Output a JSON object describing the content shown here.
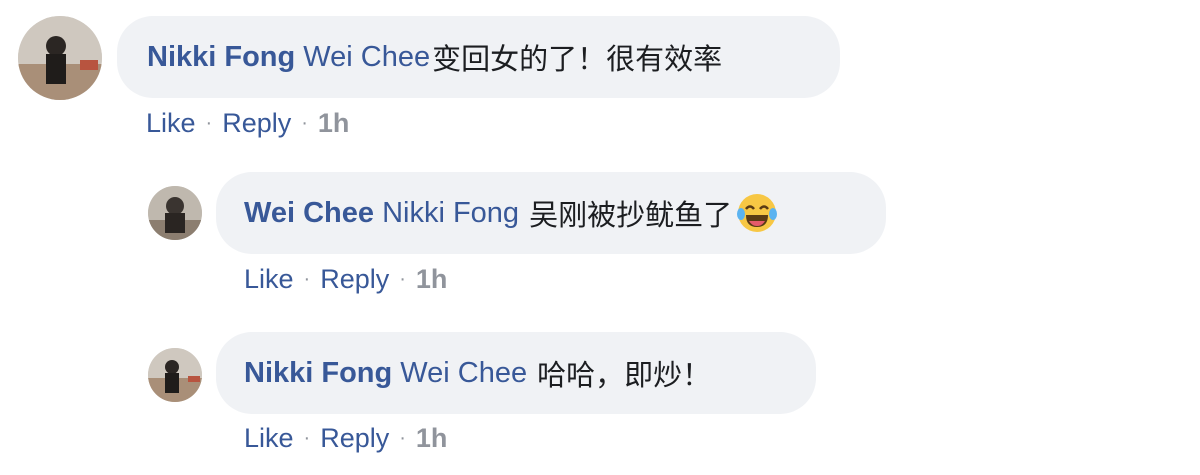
{
  "comments": [
    {
      "author": "Nikki Fong",
      "mention": "Wei Chee",
      "text": "变回女的了！很有效率",
      "actions": {
        "like": "Like",
        "reply": "Reply",
        "time": "1h"
      }
    },
    {
      "author": "Wei Chee",
      "mention": "Nikki Fong",
      "text": "吴刚被抄鱿鱼了",
      "emoji": "laughing-tears-emoji",
      "actions": {
        "like": "Like",
        "reply": "Reply",
        "time": "1h"
      }
    },
    {
      "author": "Nikki Fong",
      "mention": "Wei Chee",
      "text": "哈哈，即炒！",
      "actions": {
        "like": "Like",
        "reply": "Reply",
        "time": "1h"
      }
    }
  ],
  "colors": {
    "link": "#385898",
    "bubble": "#f0f2f5",
    "meta": "#90949c",
    "text": "#1c1e21"
  }
}
